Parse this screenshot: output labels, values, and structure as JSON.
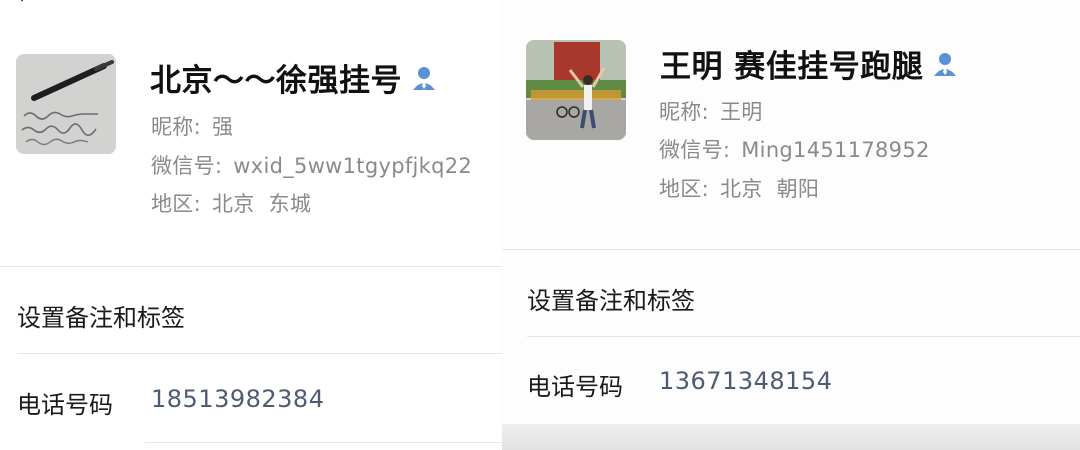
{
  "left": {
    "name": "北京～～徐强挂号",
    "nickname_label": "昵称:",
    "nickname": "强",
    "wechat_label": "微信号:",
    "wechat_id": "wxid_5ww1tgypfjkq22",
    "region_label": "地区:",
    "region_city": "北京",
    "region_district": "东城",
    "remark_tags_label": "设置备注和标签",
    "phone_label": "电话号码",
    "phone": "18513982384"
  },
  "right": {
    "name": "王明 赛佳挂号跑腿",
    "nickname_label": "昵称:",
    "nickname": "王明",
    "wechat_label": "微信号:",
    "wechat_id": "Ming1451178952",
    "region_label": "地区:",
    "region_city": "北京",
    "region_district": "朝阳",
    "remark_tags_label": "设置备注和标签",
    "phone_label": "电话号码",
    "phone": "13671348154"
  },
  "icons": {
    "back": "chevron-left-icon",
    "contact": "contact-person-icon"
  },
  "colors": {
    "contact_icon": "#5b8fd6",
    "phone_text": "#4d5b73",
    "secondary_text": "#8a8a8a"
  }
}
